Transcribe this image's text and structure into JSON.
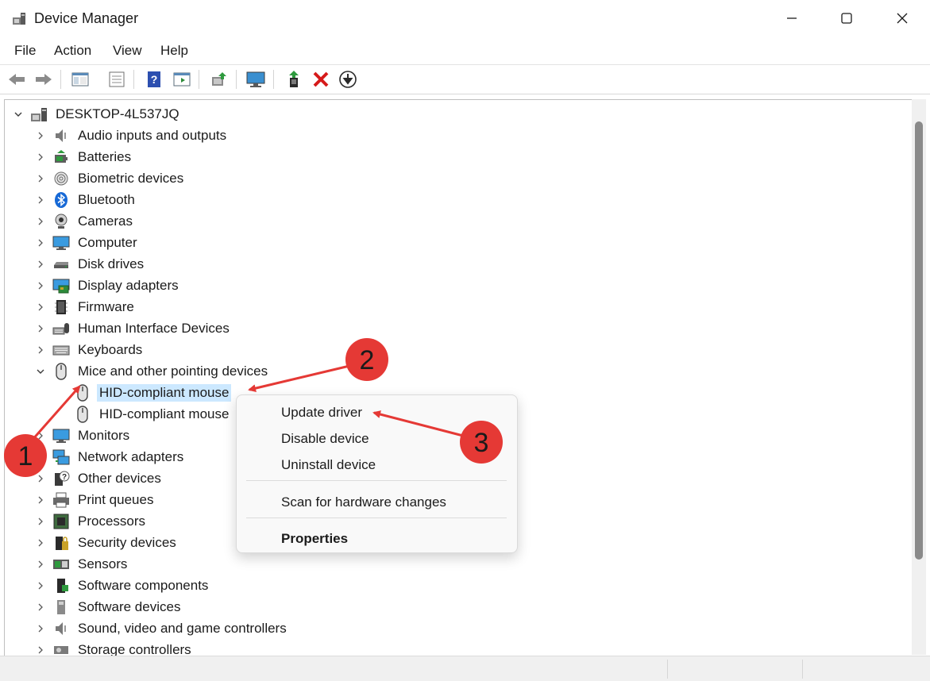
{
  "window": {
    "title": "Device Manager",
    "minimize_icon": "minimize-icon",
    "maximize_icon": "maximize-icon",
    "close_icon": "close-icon"
  },
  "menu": [
    "File",
    "Action",
    "View",
    "Help"
  ],
  "toolbar": [
    "back-arrow-icon",
    "forward-arrow-icon",
    "show-hide-console-tree-icon",
    "properties-icon",
    "help-icon",
    "action-pane-icon",
    "scan-hardware-icon",
    "monitor-icon",
    "update-driver-icon",
    "uninstall-icon",
    "disable-device-icon"
  ],
  "tree": {
    "root": "DESKTOP-4L537JQ",
    "categories": [
      "Audio inputs and outputs",
      "Batteries",
      "Biometric devices",
      "Bluetooth",
      "Cameras",
      "Computer",
      "Disk drives",
      "Display adapters",
      "Firmware",
      "Human Interface Devices",
      "Keyboards",
      "Mice and other pointing devices",
      "Monitors",
      "Network adapters",
      "Other devices",
      "Print queues",
      "Processors",
      "Security devices",
      "Sensors",
      "Software components",
      "Software devices",
      "Sound, video and game controllers",
      "Storage controllers"
    ],
    "expanded_category": "Mice and other pointing devices",
    "mice_children": [
      "HID-compliant mouse",
      "HID-compliant mouse"
    ],
    "selected": "HID-compliant mouse"
  },
  "context_menu": {
    "update": "Update driver",
    "disable": "Disable device",
    "uninstall": "Uninstall device",
    "scan": "Scan for hardware changes",
    "properties": "Properties"
  },
  "annotations": {
    "step1": "1",
    "step2": "2",
    "step3": "3",
    "color": "#e53935"
  },
  "colors": {
    "selection": "#cce8ff",
    "scrollbar_thumb": "#8a8a8a"
  }
}
